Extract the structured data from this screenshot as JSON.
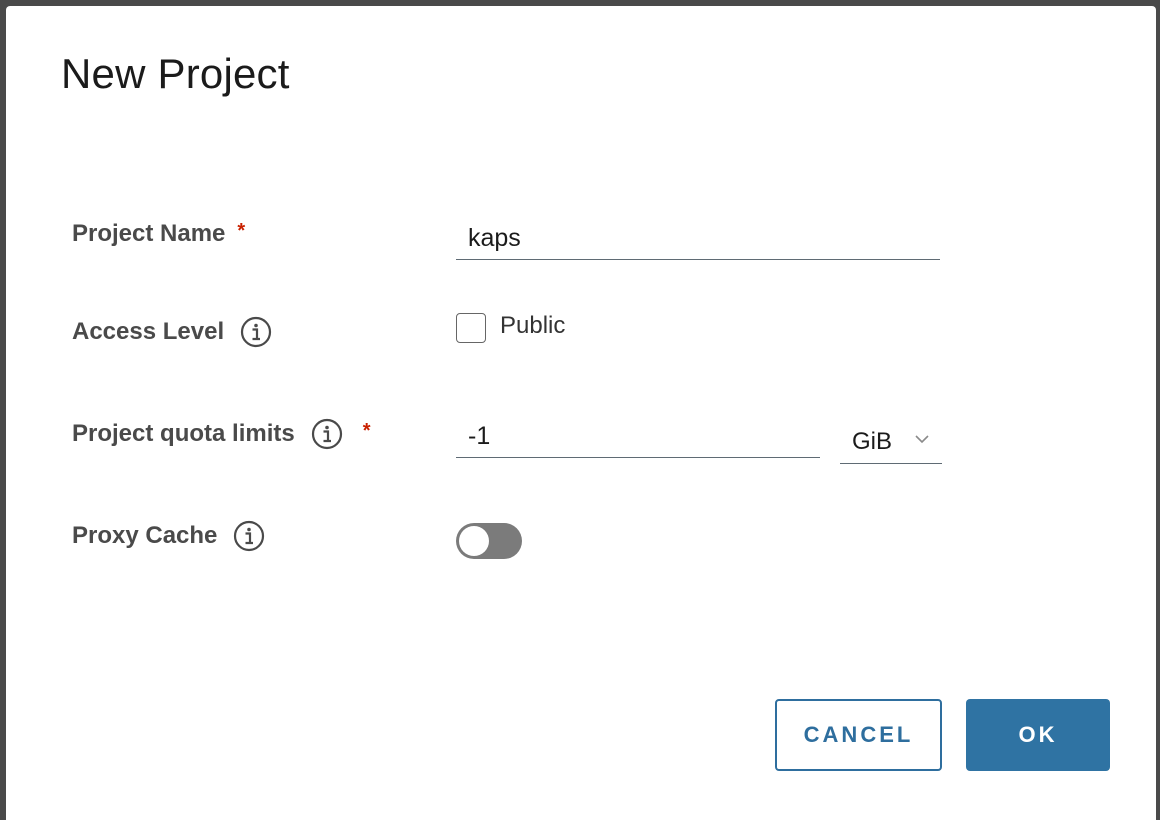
{
  "dialog": {
    "title": "New Project"
  },
  "fields": {
    "project_name": {
      "label": "Project Name",
      "required_mark": "*",
      "value": "kaps"
    },
    "access_level": {
      "label": "Access Level",
      "checkbox_label": "Public",
      "checked": false
    },
    "quota": {
      "label": "Project quota limits",
      "required_mark": "*",
      "value": "-1",
      "unit": "GiB"
    },
    "proxy_cache": {
      "label": "Proxy Cache",
      "enabled": false
    }
  },
  "buttons": {
    "cancel": "CANCEL",
    "ok": "OK"
  },
  "colors": {
    "primary": "#2f73a3",
    "required": "#c92100",
    "toggle_off": "#7b7b7b"
  },
  "icons": {
    "info": "info-circle-icon",
    "select": "chevron-down-icon"
  }
}
